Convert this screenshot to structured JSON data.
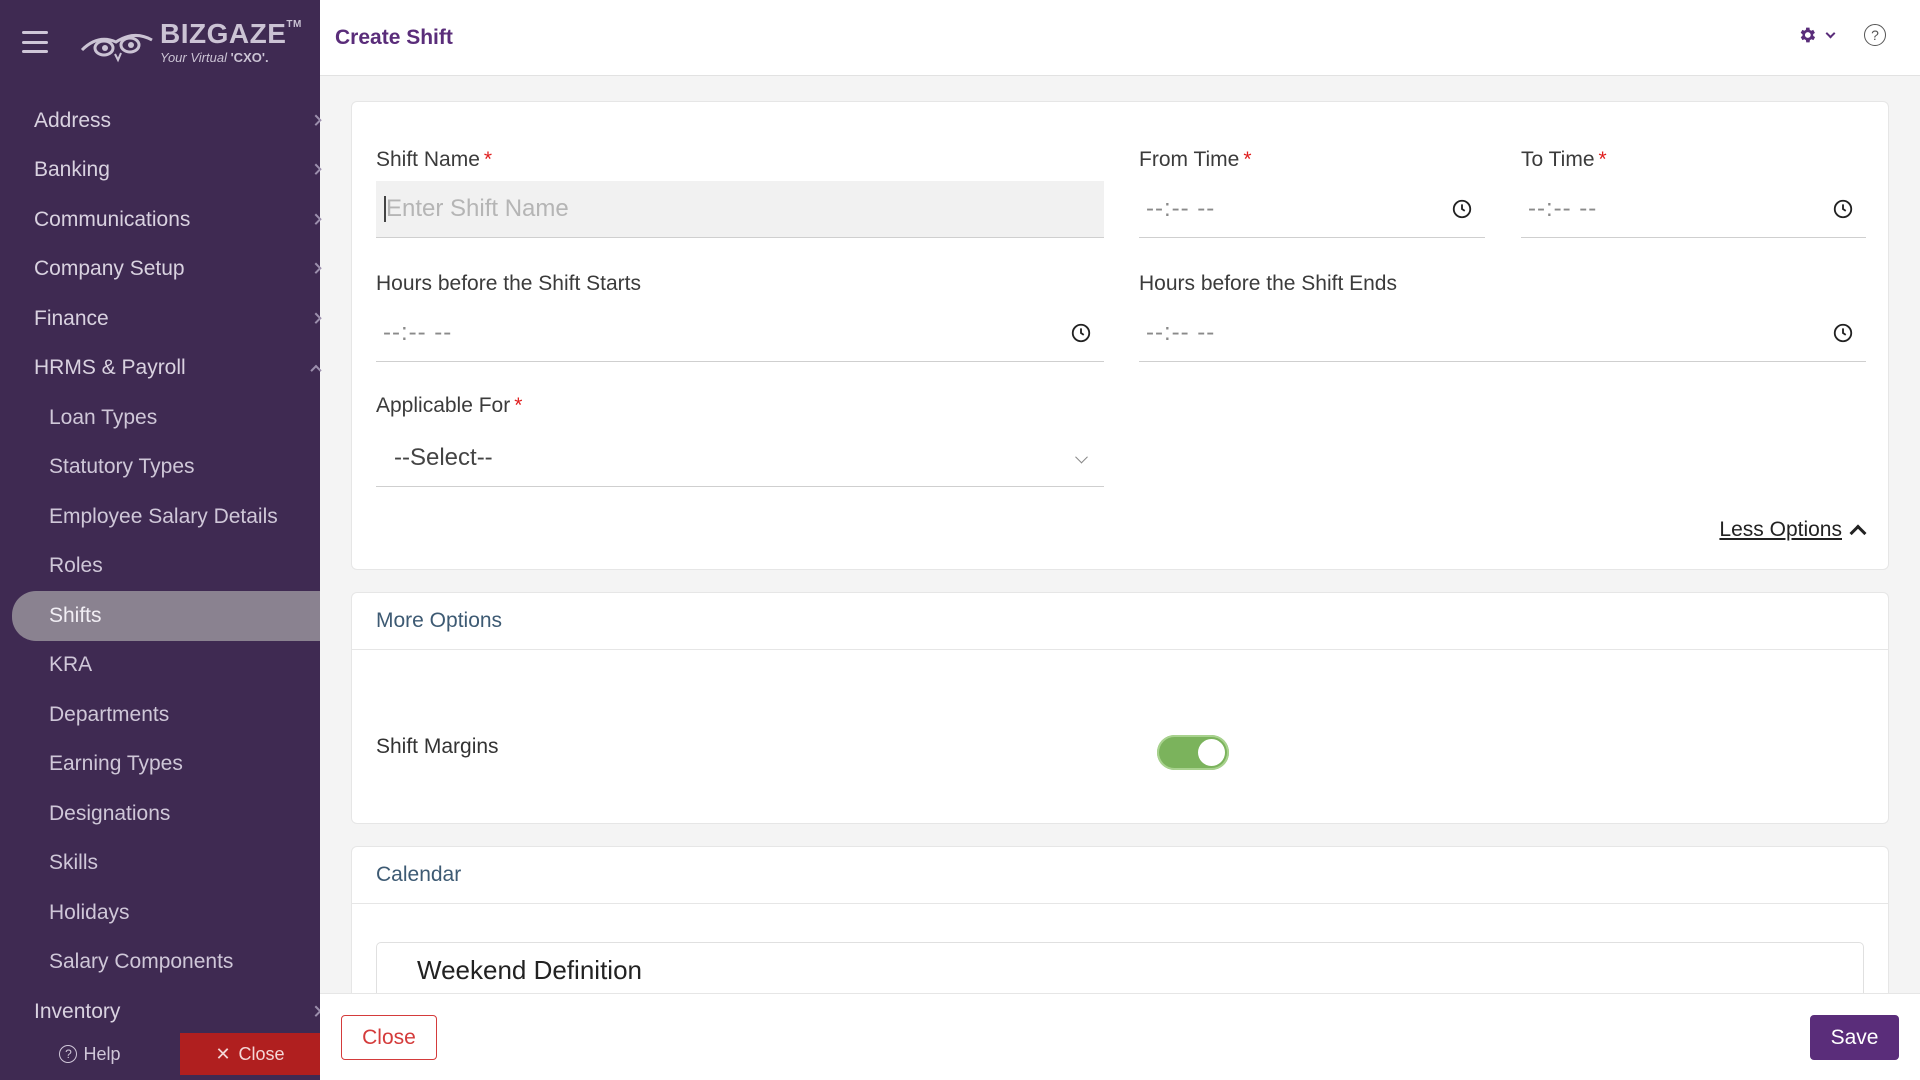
{
  "app": {
    "logo_title": "BIZGAZE",
    "logo_tm": "TM",
    "logo_tagline_prefix": "Your Virtual ",
    "logo_tagline_bold": "'CXO'."
  },
  "sidebar": {
    "groups": [
      {
        "label": "Address",
        "expanded": false
      },
      {
        "label": "Banking",
        "expanded": false
      },
      {
        "label": "Communications",
        "expanded": false
      },
      {
        "label": "Company Setup",
        "expanded": false
      },
      {
        "label": "Finance",
        "expanded": false
      },
      {
        "label": "HRMS & Payroll",
        "expanded": true
      }
    ],
    "sub_items": [
      "Loan Types",
      "Statutory Types",
      "Employee Salary Details",
      "Roles",
      "Shifts",
      "KRA",
      "Departments",
      "Earning Types",
      "Designations",
      "Skills",
      "Holidays",
      "Salary Components"
    ],
    "active_sub_item": "Shifts",
    "after_groups": [
      {
        "label": "Inventory",
        "expanded": false
      }
    ],
    "footer": {
      "help_label": "Help",
      "close_label": "Close"
    }
  },
  "topbar": {
    "title": "Create Shift",
    "settings_icon": "gear-icon",
    "help_icon": "help-circle-icon"
  },
  "form": {
    "shift_name": {
      "label": "Shift Name",
      "required": true,
      "placeholder": "Enter Shift Name",
      "value": ""
    },
    "from_time": {
      "label": "From Time",
      "required": true,
      "value": "--:-- --"
    },
    "to_time": {
      "label": "To Time",
      "required": true,
      "value": "--:-- --"
    },
    "hours_before_start": {
      "label": "Hours before the Shift Starts",
      "value": "--:-- --"
    },
    "hours_before_end": {
      "label": "Hours before the Shift Ends",
      "value": "--:-- --"
    },
    "applicable_for": {
      "label": "Applicable For",
      "required": true,
      "selected": "--Select--"
    },
    "required_mark": "*",
    "less_options_label": "Less Options"
  },
  "more_options": {
    "title": "More Options",
    "shift_margins_label": "Shift Margins",
    "shift_margins_on": true
  },
  "calendar": {
    "title": "Calendar",
    "weekend_definition_label": "Weekend Definition"
  },
  "actions": {
    "close_label": "Close",
    "save_label": "Save"
  },
  "colors": {
    "brand": "#5a2d7a",
    "sidebar_bg": "#3f2a52",
    "danger": "#d43b3b",
    "toggle_on": "#7bb35c"
  }
}
